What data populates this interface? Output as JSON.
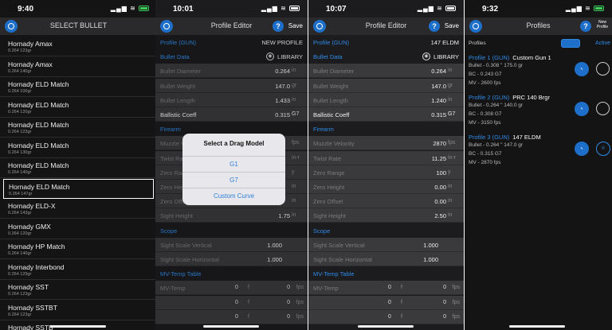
{
  "panel1": {
    "time": "9:40",
    "title": "SELECT BULLET",
    "bullets": [
      {
        "name": "Hornady Amax",
        "sub": "0.264 123gr"
      },
      {
        "name": "Hornady Amax",
        "sub": "0.264 140gr"
      },
      {
        "name": "Hornady ELD Match",
        "sub": "0.264 100gr"
      },
      {
        "name": "Hornady ELD Match",
        "sub": "0.264 120gr"
      },
      {
        "name": "Hornady ELD Match",
        "sub": "0.264 123gr"
      },
      {
        "name": "Hornady ELD Match",
        "sub": "0.264 130gr"
      },
      {
        "name": "Hornady ELD Match",
        "sub": "0.264 140gr"
      },
      {
        "name": "Hornady ELD Match",
        "sub": "0.264 147gr"
      },
      {
        "name": "Hornady ELD-X",
        "sub": "0.264 143gr"
      },
      {
        "name": "Hornady GMX",
        "sub": "0.264 120gr"
      },
      {
        "name": "Hornady HP Match",
        "sub": "0.264 140gr"
      },
      {
        "name": "Hornady Interbond",
        "sub": "0.264 129gr"
      },
      {
        "name": "Hornady SST",
        "sub": "0.264 123gr"
      },
      {
        "name": "Hornady SSTBT",
        "sub": "0.264 123gr"
      },
      {
        "name": "Hornady SSTB",
        "sub": ""
      }
    ],
    "selected_index": 7
  },
  "panel2": {
    "time": "10:01",
    "title": "Profile Editor",
    "save": "Save",
    "profile_label": "Profile (GUN)",
    "profile_value": "NEW PROFILE",
    "bullet_data_label": "Bullet Data",
    "library": "LIBRARY",
    "rows": [
      {
        "label": "Bullet Diameter",
        "value": "0.264",
        "unit": "in"
      },
      {
        "label": "Bullet Weight",
        "value": "147.0",
        "unit": "gr"
      },
      {
        "label": "Bullet Length",
        "value": "1.433",
        "unit": "in"
      },
      {
        "label": "Ballistic Coeff",
        "value": "0.315",
        "unit": "G7"
      }
    ],
    "firearm_label": "Firearm",
    "firearm_rows": [
      {
        "label": "Muzzle Velocity",
        "value": "",
        "unit": "fps"
      },
      {
        "label": "Twist Rate",
        "value": "",
        "unit": "in-r"
      },
      {
        "label": "Zero Range",
        "value": "",
        "unit": "y"
      },
      {
        "label": "Zero Height",
        "value": "",
        "unit": "in"
      },
      {
        "label": "Zero Offset",
        "value": "",
        "unit": "in"
      },
      {
        "label": "Sight Height",
        "value": "1.75",
        "unit": "in"
      }
    ],
    "scope_label": "Scope",
    "scope_rows": [
      {
        "label": "Sight Scale Vertical",
        "value": "1.000"
      },
      {
        "label": "Sight Scale Horizontal",
        "value": "1.000"
      }
    ],
    "mv_label": "MV-Temp Table",
    "mv_rows": [
      {
        "label": "MV-Temp",
        "t": "0",
        "tu": "f",
        "v": "0",
        "vu": "fps"
      },
      {
        "label": "",
        "t": "0",
        "tu": "f",
        "v": "0",
        "vu": "fps"
      },
      {
        "label": "",
        "t": "0",
        "tu": "f",
        "v": "0",
        "vu": "fps"
      }
    ],
    "modal": {
      "title": "Select a Drag Model",
      "options": [
        "G1",
        "G7",
        "Custom Curve"
      ]
    }
  },
  "panel3": {
    "time": "10:07",
    "title": "Profile Editor",
    "save": "Save",
    "profile_label": "Profile (GUN)",
    "profile_value": "147 ELDM",
    "bullet_data_label": "Bullet Data",
    "library": "LIBRARY",
    "rows": [
      {
        "label": "Bullet Diameter",
        "value": "0.264",
        "unit": "in"
      },
      {
        "label": "Bullet Weight",
        "value": "147.0",
        "unit": "gr"
      },
      {
        "label": "Bullet Length",
        "value": "1.240",
        "unit": "in"
      },
      {
        "label": "Ballistic Coeff",
        "value": "0.315",
        "unit": "G7"
      }
    ],
    "firearm_label": "Firearm",
    "firearm_rows": [
      {
        "label": "Muzzle Velocity",
        "value": "2870",
        "unit": "fps"
      },
      {
        "label": "Twist Rate",
        "value": "11.25",
        "unit": "in-r"
      },
      {
        "label": "Zero Range",
        "value": "100",
        "unit": "y"
      },
      {
        "label": "Zero Height",
        "value": "0.00",
        "unit": "in"
      },
      {
        "label": "Zero Offset",
        "value": "0.00",
        "unit": "in"
      },
      {
        "label": "Sight Height",
        "value": "2.50",
        "unit": "in"
      }
    ],
    "scope_label": "Scope",
    "scope_rows": [
      {
        "label": "Sight Scale Vertical",
        "value": "1.000"
      },
      {
        "label": "Sight Scale Horizontal",
        "value": "1.000"
      }
    ],
    "mv_label": "MV-Temp Table",
    "mv_rows": [
      {
        "label": "MV-Temp",
        "t": "0",
        "tu": "f",
        "v": "0",
        "vu": "fps"
      },
      {
        "label": "",
        "t": "0",
        "tu": "f",
        "v": "0",
        "vu": "fps"
      },
      {
        "label": "",
        "t": "0",
        "tu": "f",
        "v": "0",
        "vu": "fps"
      }
    ]
  },
  "panel4": {
    "time": "9:32",
    "title": "Profiles",
    "new_profile": "New Profile",
    "profiles_label": "Profiles",
    "active_label": "Active",
    "profiles": [
      {
        "head": "Profile 1 (GUN)",
        "name": "Custom Gun 1",
        "bullet": "Bullet - 0.308 \" 175.0 gr",
        "bc": "BC - 0.243  G7",
        "mv": "MV - 2600  fps"
      },
      {
        "head": "Profile 2 (GUN)",
        "name": "PRC 140 Brgr",
        "bullet": "Bullet - 0.264 \" 140.0 gr",
        "bc": "BC - 0.308  G7",
        "mv": "MV - 3150  fps"
      },
      {
        "head": "Profile 3 (GUN)",
        "name": "147 ELDM",
        "bullet": "Bullet - 0.264 \" 147.0 gr",
        "bc": "BC - 0.315  G7",
        "mv": "MV - 2870  fps"
      }
    ]
  }
}
